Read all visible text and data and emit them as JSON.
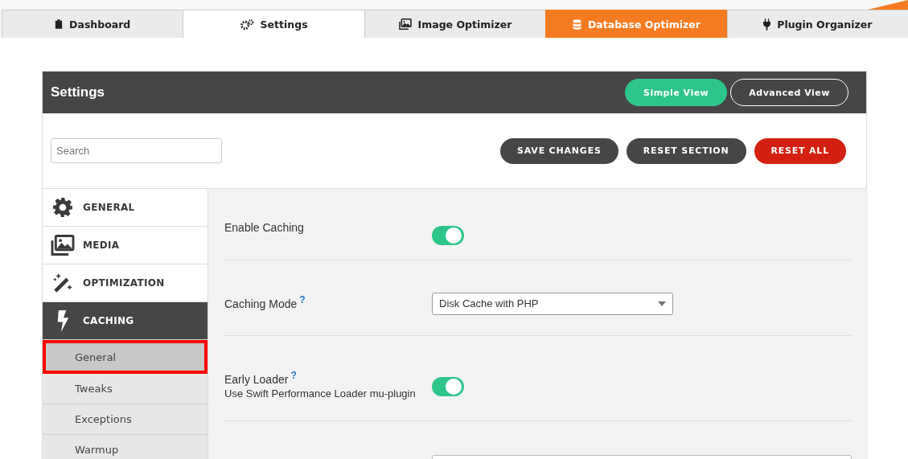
{
  "tabs": [
    {
      "label": "Dashboard",
      "selected": false,
      "accent": false
    },
    {
      "label": "Settings",
      "selected": true,
      "accent": false
    },
    {
      "label": "Image Optimizer",
      "selected": false,
      "accent": false
    },
    {
      "label": "Database Optimizer",
      "selected": false,
      "accent": true
    },
    {
      "label": "Plugin Organizer",
      "selected": false,
      "accent": false
    }
  ],
  "panel": {
    "title": "Settings",
    "views": [
      {
        "label": "Simple View",
        "selected": true
      },
      {
        "label": "Advanced View",
        "selected": false
      }
    ]
  },
  "search": {
    "placeholder": "Search"
  },
  "actions": [
    {
      "label": "SAVE CHANGES",
      "kind": "dark"
    },
    {
      "label": "RESET SECTION",
      "kind": "dark"
    },
    {
      "label": "RESET ALL",
      "kind": "danger"
    }
  ],
  "sidebar": {
    "items": [
      {
        "label": "GENERAL",
        "selected": false
      },
      {
        "label": "MEDIA",
        "selected": false
      },
      {
        "label": "OPTIMIZATION",
        "selected": false
      },
      {
        "label": "CACHING",
        "selected": true,
        "children": [
          {
            "label": "General",
            "selected": true
          },
          {
            "label": "Tweaks",
            "selected": false
          },
          {
            "label": "Exceptions",
            "selected": false
          },
          {
            "label": "Warmup",
            "selected": false
          }
        ]
      }
    ]
  },
  "settings": [
    {
      "kind": "toggle",
      "label": "Enable Caching",
      "on": true
    },
    {
      "kind": "select",
      "label": "Caching Mode",
      "help_mark": "?",
      "value": "Disk Cache with PHP"
    },
    {
      "kind": "toggle",
      "label": "Early Loader",
      "help_mark": "?",
      "description": "Use Swift Performance Loader mu-plugin",
      "on": true
    },
    {
      "kind": "input"
    }
  ]
}
